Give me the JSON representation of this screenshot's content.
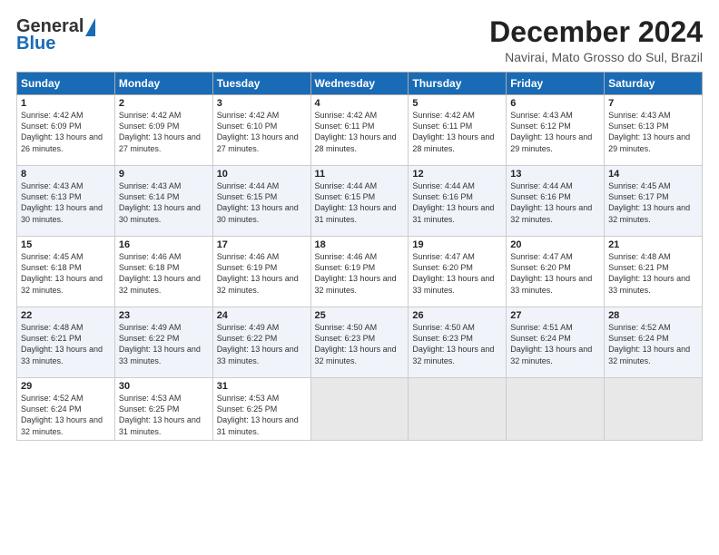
{
  "header": {
    "logo_general": "General",
    "logo_blue": "Blue",
    "month_title": "December 2024",
    "location": "Navirai, Mato Grosso do Sul, Brazil"
  },
  "days_of_week": [
    "Sunday",
    "Monday",
    "Tuesday",
    "Wednesday",
    "Thursday",
    "Friday",
    "Saturday"
  ],
  "weeks": [
    [
      {
        "day": "1",
        "sunrise": "Sunrise: 4:42 AM",
        "sunset": "Sunset: 6:09 PM",
        "daylight": "Daylight: 13 hours and 26 minutes."
      },
      {
        "day": "2",
        "sunrise": "Sunrise: 4:42 AM",
        "sunset": "Sunset: 6:09 PM",
        "daylight": "Daylight: 13 hours and 27 minutes."
      },
      {
        "day": "3",
        "sunrise": "Sunrise: 4:42 AM",
        "sunset": "Sunset: 6:10 PM",
        "daylight": "Daylight: 13 hours and 27 minutes."
      },
      {
        "day": "4",
        "sunrise": "Sunrise: 4:42 AM",
        "sunset": "Sunset: 6:11 PM",
        "daylight": "Daylight: 13 hours and 28 minutes."
      },
      {
        "day": "5",
        "sunrise": "Sunrise: 4:42 AM",
        "sunset": "Sunset: 6:11 PM",
        "daylight": "Daylight: 13 hours and 28 minutes."
      },
      {
        "day": "6",
        "sunrise": "Sunrise: 4:43 AM",
        "sunset": "Sunset: 6:12 PM",
        "daylight": "Daylight: 13 hours and 29 minutes."
      },
      {
        "day": "7",
        "sunrise": "Sunrise: 4:43 AM",
        "sunset": "Sunset: 6:13 PM",
        "daylight": "Daylight: 13 hours and 29 minutes."
      }
    ],
    [
      {
        "day": "8",
        "sunrise": "Sunrise: 4:43 AM",
        "sunset": "Sunset: 6:13 PM",
        "daylight": "Daylight: 13 hours and 30 minutes."
      },
      {
        "day": "9",
        "sunrise": "Sunrise: 4:43 AM",
        "sunset": "Sunset: 6:14 PM",
        "daylight": "Daylight: 13 hours and 30 minutes."
      },
      {
        "day": "10",
        "sunrise": "Sunrise: 4:44 AM",
        "sunset": "Sunset: 6:15 PM",
        "daylight": "Daylight: 13 hours and 30 minutes."
      },
      {
        "day": "11",
        "sunrise": "Sunrise: 4:44 AM",
        "sunset": "Sunset: 6:15 PM",
        "daylight": "Daylight: 13 hours and 31 minutes."
      },
      {
        "day": "12",
        "sunrise": "Sunrise: 4:44 AM",
        "sunset": "Sunset: 6:16 PM",
        "daylight": "Daylight: 13 hours and 31 minutes."
      },
      {
        "day": "13",
        "sunrise": "Sunrise: 4:44 AM",
        "sunset": "Sunset: 6:16 PM",
        "daylight": "Daylight: 13 hours and 32 minutes."
      },
      {
        "day": "14",
        "sunrise": "Sunrise: 4:45 AM",
        "sunset": "Sunset: 6:17 PM",
        "daylight": "Daylight: 13 hours and 32 minutes."
      }
    ],
    [
      {
        "day": "15",
        "sunrise": "Sunrise: 4:45 AM",
        "sunset": "Sunset: 6:18 PM",
        "daylight": "Daylight: 13 hours and 32 minutes."
      },
      {
        "day": "16",
        "sunrise": "Sunrise: 4:46 AM",
        "sunset": "Sunset: 6:18 PM",
        "daylight": "Daylight: 13 hours and 32 minutes."
      },
      {
        "day": "17",
        "sunrise": "Sunrise: 4:46 AM",
        "sunset": "Sunset: 6:19 PM",
        "daylight": "Daylight: 13 hours and 32 minutes."
      },
      {
        "day": "18",
        "sunrise": "Sunrise: 4:46 AM",
        "sunset": "Sunset: 6:19 PM",
        "daylight": "Daylight: 13 hours and 32 minutes."
      },
      {
        "day": "19",
        "sunrise": "Sunrise: 4:47 AM",
        "sunset": "Sunset: 6:20 PM",
        "daylight": "Daylight: 13 hours and 33 minutes."
      },
      {
        "day": "20",
        "sunrise": "Sunrise: 4:47 AM",
        "sunset": "Sunset: 6:20 PM",
        "daylight": "Daylight: 13 hours and 33 minutes."
      },
      {
        "day": "21",
        "sunrise": "Sunrise: 4:48 AM",
        "sunset": "Sunset: 6:21 PM",
        "daylight": "Daylight: 13 hours and 33 minutes."
      }
    ],
    [
      {
        "day": "22",
        "sunrise": "Sunrise: 4:48 AM",
        "sunset": "Sunset: 6:21 PM",
        "daylight": "Daylight: 13 hours and 33 minutes."
      },
      {
        "day": "23",
        "sunrise": "Sunrise: 4:49 AM",
        "sunset": "Sunset: 6:22 PM",
        "daylight": "Daylight: 13 hours and 33 minutes."
      },
      {
        "day": "24",
        "sunrise": "Sunrise: 4:49 AM",
        "sunset": "Sunset: 6:22 PM",
        "daylight": "Daylight: 13 hours and 33 minutes."
      },
      {
        "day": "25",
        "sunrise": "Sunrise: 4:50 AM",
        "sunset": "Sunset: 6:23 PM",
        "daylight": "Daylight: 13 hours and 32 minutes."
      },
      {
        "day": "26",
        "sunrise": "Sunrise: 4:50 AM",
        "sunset": "Sunset: 6:23 PM",
        "daylight": "Daylight: 13 hours and 32 minutes."
      },
      {
        "day": "27",
        "sunrise": "Sunrise: 4:51 AM",
        "sunset": "Sunset: 6:24 PM",
        "daylight": "Daylight: 13 hours and 32 minutes."
      },
      {
        "day": "28",
        "sunrise": "Sunrise: 4:52 AM",
        "sunset": "Sunset: 6:24 PM",
        "daylight": "Daylight: 13 hours and 32 minutes."
      }
    ],
    [
      {
        "day": "29",
        "sunrise": "Sunrise: 4:52 AM",
        "sunset": "Sunset: 6:24 PM",
        "daylight": "Daylight: 13 hours and 32 minutes."
      },
      {
        "day": "30",
        "sunrise": "Sunrise: 4:53 AM",
        "sunset": "Sunset: 6:25 PM",
        "daylight": "Daylight: 13 hours and 31 minutes."
      },
      {
        "day": "31",
        "sunrise": "Sunrise: 4:53 AM",
        "sunset": "Sunset: 6:25 PM",
        "daylight": "Daylight: 13 hours and 31 minutes."
      },
      {
        "day": "",
        "sunrise": "",
        "sunset": "",
        "daylight": ""
      },
      {
        "day": "",
        "sunrise": "",
        "sunset": "",
        "daylight": ""
      },
      {
        "day": "",
        "sunrise": "",
        "sunset": "",
        "daylight": ""
      },
      {
        "day": "",
        "sunrise": "",
        "sunset": "",
        "daylight": ""
      }
    ]
  ]
}
